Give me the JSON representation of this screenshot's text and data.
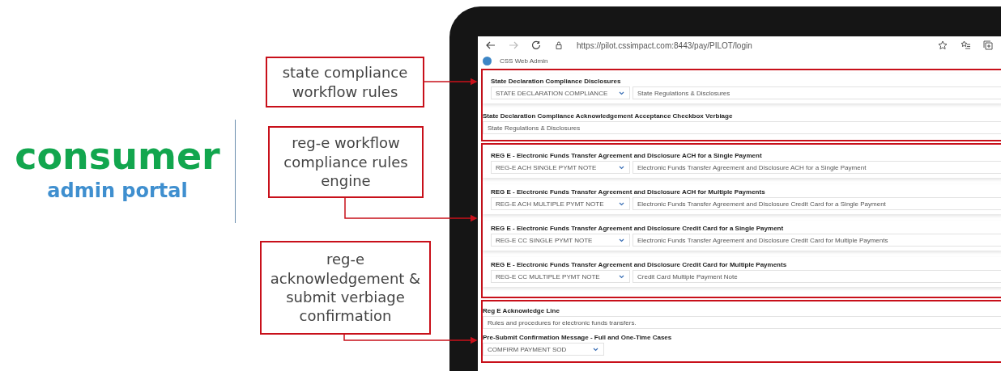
{
  "brand": {
    "title": "consumer",
    "subtitle": "admin portal"
  },
  "callouts": [
    {
      "text": "state compliance workflow rules"
    },
    {
      "text": "reg-e workflow compliance rules engine"
    },
    {
      "text": "reg-e acknowledgement & submit verbiage confirmation"
    }
  ],
  "browser": {
    "url": "https://pilot.cssimpact.com:8443/pay/PILOT/login"
  },
  "app": {
    "title": "CSS Web Admin"
  },
  "sections": [
    {
      "fields": [
        {
          "kind": "select_text",
          "label": "State Declaration Compliance Disclosures",
          "select": "STATE DECLARATION COMPLIANCE",
          "value": "State Regulations & Disclosures"
        },
        {
          "kind": "text",
          "label": "State Declaration Compliance Acknowledgement Acceptance Checkbox Verbiage",
          "value": "State Regulations & Disclosures"
        }
      ]
    },
    {
      "fields": [
        {
          "kind": "select_text",
          "label": "REG E - Electronic Funds Transfer Agreement and Disclosure ACH for a Single Payment",
          "select": "REG-E ACH SINGLE PYMT NOTE",
          "value": "Electronic Funds Transfer Agreement and Disclosure ACH for a Single Payment"
        },
        {
          "kind": "select_text",
          "label": "REG E - Electronic Funds Transfer Agreement and Disclosure ACH for Multiple Payments",
          "select": "REG-E ACH MULTIPLE PYMT NOTE",
          "value": "Electronic Funds Transfer Agreement and Disclosure Credit Card for a Single Payment"
        },
        {
          "kind": "select_text",
          "label": "REG E - Electronic Funds Transfer Agreement and Disclosure Credit Card for a Single Payment",
          "select": "REG-E CC SINGLE PYMT NOTE",
          "value": "Electronic Funds Transfer Agreement and Disclosure Credit Card for Multiple Payments"
        },
        {
          "kind": "select_text",
          "label": "REG E - Electronic Funds Transfer Agreement and Disclosure Credit Card for Multiple Payments",
          "select": "REG-E CC MULTIPLE PYMT NOTE",
          "value": "Credit Card Multiple Payment Note"
        }
      ]
    },
    {
      "fields": [
        {
          "kind": "text",
          "label": "Reg E Acknowledge Line",
          "value": "Rules and procedures for electronic funds transfers."
        },
        {
          "kind": "select",
          "label": "Pre-Submit Confirmation Message - Full and One-Time Cases",
          "select": "COMFIRM PAYMENT SOD"
        }
      ]
    }
  ]
}
